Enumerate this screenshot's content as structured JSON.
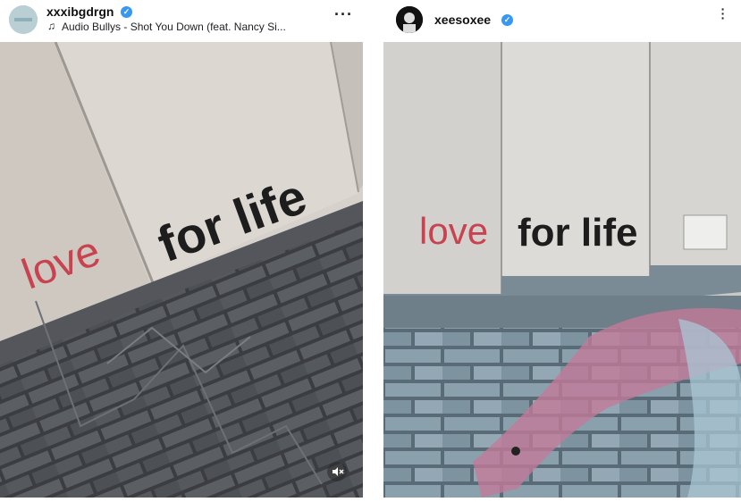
{
  "posts": [
    {
      "username": "xxxibgdrgn",
      "verified": true,
      "music_icon": "music-note-icon",
      "music": "Audio Bullys - Shot You Down (feat. Nancy Si...",
      "more_icon": "more-horizontal-icon",
      "graffiti": [
        "love",
        "for life"
      ],
      "mute_icon": "speaker-muted-icon"
    },
    {
      "username": "xeesoxee",
      "verified": true,
      "more_icon": "more-vertical-icon",
      "graffiti": [
        "love",
        "for life"
      ]
    }
  ],
  "colors": {
    "verified_badge": "#3897f0",
    "graffiti_red": "#c8434f",
    "graffiti_black": "#1d1d1d"
  }
}
